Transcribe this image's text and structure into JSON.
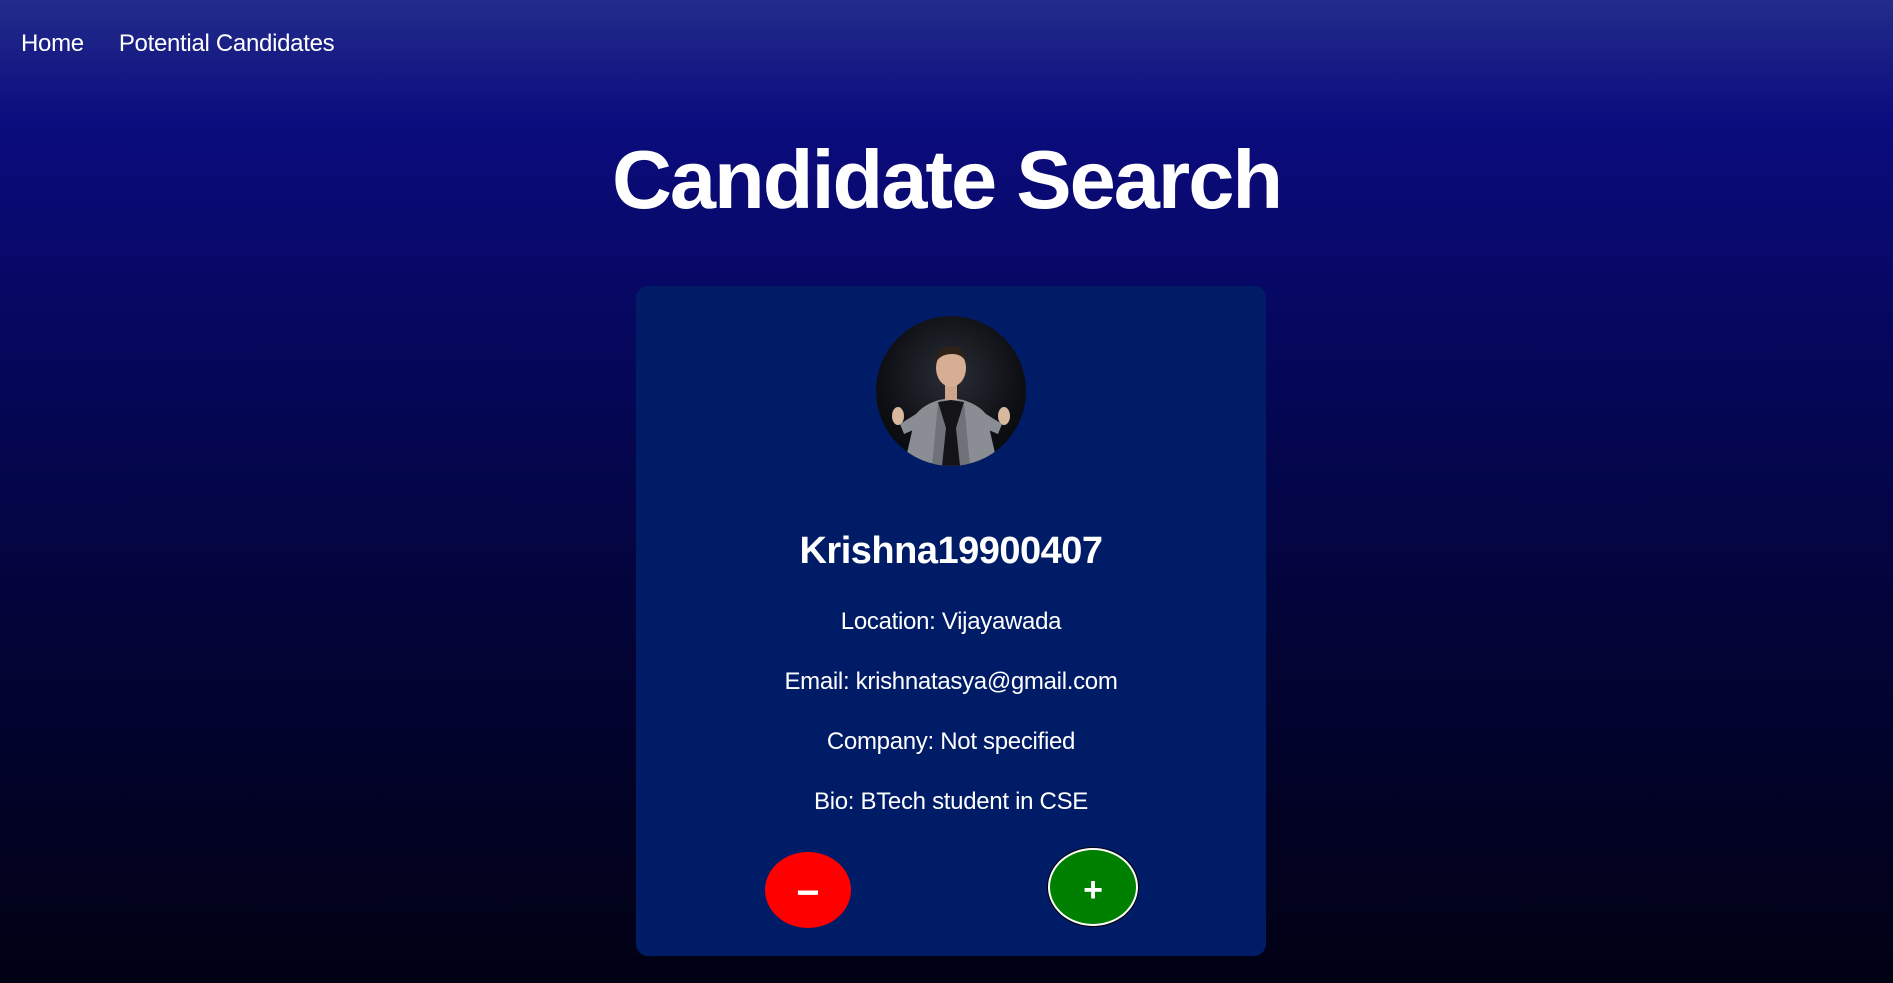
{
  "nav": {
    "home_label": "Home",
    "potential_label": "Potential Candidates"
  },
  "page": {
    "title": "Candidate Search"
  },
  "candidate": {
    "username": "Krishna19900407",
    "location": "Location: Vijayawada",
    "email": "Email: krishnatasya@gmail.com",
    "company": "Company: Not specified",
    "bio": "Bio: BTech student in CSE"
  },
  "actions": {
    "reject_label": "−",
    "accept_label": "+"
  },
  "colors": {
    "card_background": "#001c66",
    "reject": "#ff0000",
    "accept": "#008000"
  },
  "icons": {
    "avatar": "user-avatar-photo"
  }
}
